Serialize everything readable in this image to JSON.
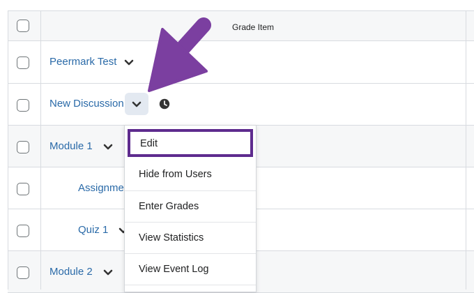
{
  "table": {
    "header": {
      "grade_item_label": "Grade Item"
    },
    "rows": [
      {
        "label": "Peermark Test"
      },
      {
        "label": "New Discussion"
      },
      {
        "label": "Module 1"
      },
      {
        "label": "Assignmer"
      },
      {
        "label": "Quiz 1"
      },
      {
        "label": "Module 2"
      }
    ]
  },
  "context_menu": {
    "items": [
      {
        "label": "Edit"
      },
      {
        "label": "Hide from Users"
      },
      {
        "label": "Enter Grades"
      },
      {
        "label": "View Statistics"
      },
      {
        "label": "View Event Log"
      }
    ]
  },
  "colors": {
    "link": "#2a6aa8",
    "highlight": "#5e2b8e",
    "arrow": "#7b3fa0",
    "row_alt": "#f6f7f8"
  },
  "icons": {
    "chevron": "chevron-down-icon",
    "clock": "clock-icon",
    "arrow": "pointer-arrow-icon"
  }
}
